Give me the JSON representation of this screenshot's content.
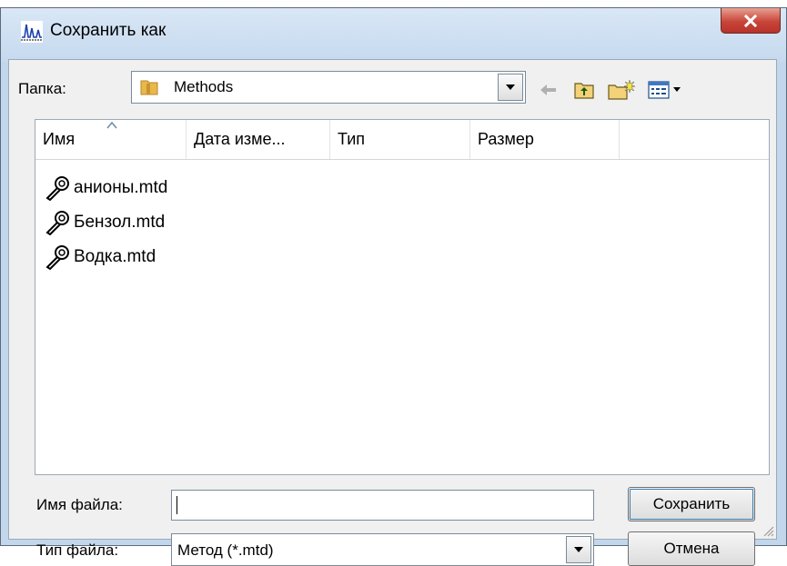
{
  "dialog": {
    "title": "Сохранить как",
    "folder_label": "Папка:",
    "folder_value": "Methods"
  },
  "columns": [
    "Имя",
    "Дата изме...",
    "Тип",
    "Размер"
  ],
  "files": [
    "анионы.mtd",
    "Бензол.mtd",
    "Водка.mtd"
  ],
  "filename": {
    "label": "Имя файла:",
    "value": ""
  },
  "filetype": {
    "label": "Тип файла:",
    "value": "Метод (*.mtd)"
  },
  "buttons": {
    "save": "Сохранить",
    "cancel": "Отмена"
  },
  "icons": {
    "app": "chromatogram-app-icon",
    "close": "close-icon",
    "folder": "folder-icon",
    "back": "back-arrow-icon",
    "up": "up-folder-icon",
    "new_folder": "new-folder-icon",
    "view_menu": "view-menu-icon",
    "file": "wrench-file-icon"
  },
  "colors": {
    "close_button": "#c8453a",
    "title_bar": "#c5d9ee",
    "client_bg": "#f0f0f0"
  }
}
